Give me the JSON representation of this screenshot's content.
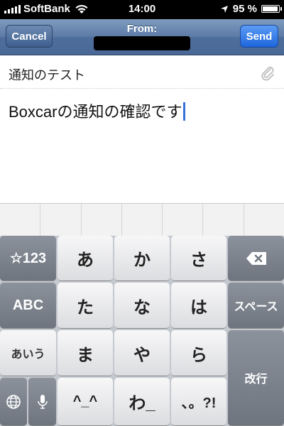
{
  "status_bar": {
    "carrier": "SoftBank",
    "time": "14:00",
    "battery": "95 %",
    "battery_level": 0.95
  },
  "nav": {
    "cancel_label": "Cancel",
    "from_label": "From:",
    "send_label": "Send"
  },
  "compose": {
    "subject": "通知のテスト",
    "body": "Boxcarの通知の確認です"
  },
  "keyboard": {
    "num_key": "☆123",
    "abc_key": "ABC",
    "kana_key": "あいう",
    "space_key": "スペース",
    "return_key": "改行",
    "keys": {
      "a": "あ",
      "ka": "か",
      "sa": "さ",
      "ta": "た",
      "na": "な",
      "ha": "は",
      "ma": "ま",
      "ya": "や",
      "ra": "ら",
      "dakuten": "^_^",
      "wa": "わ_",
      "punct": "、。?!"
    }
  }
}
